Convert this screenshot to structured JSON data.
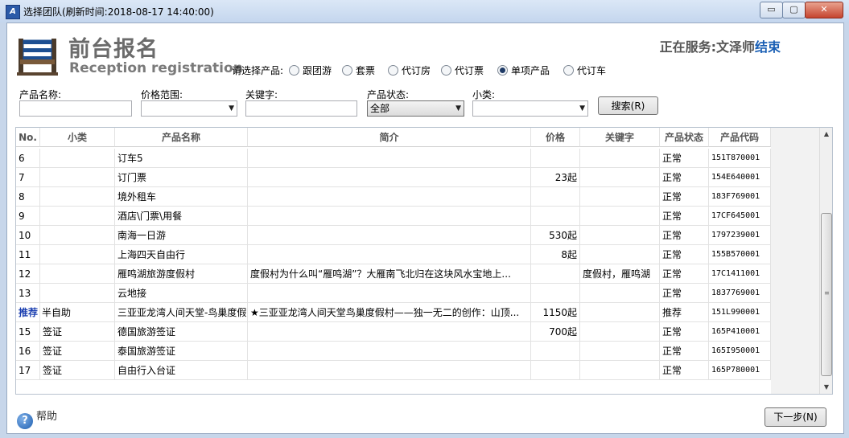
{
  "window": {
    "title": "选择团队(刷新时间:2018-08-17   14:40:00)",
    "controls": {
      "minimize": "▭",
      "maximize": "▢",
      "close": "✕"
    }
  },
  "header": {
    "title": "前台报名",
    "subtitle": "Reception registration",
    "serving_prefix": "正在服务:文泽师",
    "serving_action": "结束"
  },
  "product_type": {
    "label": "请选择产品:",
    "options": [
      "跟团游",
      "套票",
      "代订房",
      "代订票",
      "单项产品",
      "代订车"
    ],
    "selected_index": 4
  },
  "filters": {
    "name_label": "产品名称:",
    "name_value": "",
    "price_label": "价格范围:",
    "price_value": "",
    "keyword_label": "关键字:",
    "keyword_value": "",
    "status_label": "产品状态:",
    "status_value": "全部",
    "subtype_label": "小类:",
    "subtype_value": "",
    "search_label": "搜索(R)"
  },
  "table": {
    "columns": [
      "No.",
      "小类",
      "产品名称",
      "简介",
      "价格",
      "关键字",
      "产品状态",
      "产品代码"
    ],
    "rows": [
      {
        "no": "6",
        "tag": "",
        "subtype": "",
        "name": "订车5",
        "intro": "",
        "price": "",
        "keyword": "",
        "status": "正常",
        "code": "151T870001"
      },
      {
        "no": "7",
        "tag": "",
        "subtype": "",
        "name": "订门票",
        "intro": "",
        "price": "23起",
        "keyword": "",
        "status": "正常",
        "code": "154E640001"
      },
      {
        "no": "8",
        "tag": "",
        "subtype": "",
        "name": "境外租车",
        "intro": "",
        "price": "",
        "keyword": "",
        "status": "正常",
        "code": "183F769001"
      },
      {
        "no": "9",
        "tag": "",
        "subtype": "",
        "name": "酒店\\门票\\用餐",
        "intro": "",
        "price": "",
        "keyword": "",
        "status": "正常",
        "code": "17CF645001"
      },
      {
        "no": "10",
        "tag": "",
        "subtype": "",
        "name": "南海一日游",
        "intro": "",
        "price": "530起",
        "keyword": "",
        "status": "正常",
        "code": "1797239001"
      },
      {
        "no": "11",
        "tag": "",
        "subtype": "",
        "name": "上海四天自由行",
        "intro": "",
        "price": "8起",
        "keyword": "",
        "status": "正常",
        "code": "155B570001"
      },
      {
        "no": "12",
        "tag": "",
        "subtype": "",
        "name": "雁鸣湖旅游度假村",
        "intro": "度假村为什么叫“雁鸣湖”？大雁南飞北归在这块风水宝地上...",
        "price": "",
        "keyword": "度假村，雁鸣湖",
        "status": "正常",
        "code": "17C1411001"
      },
      {
        "no": "13",
        "tag": "",
        "subtype": "",
        "name": "云地接",
        "intro": "",
        "price": "",
        "keyword": "",
        "status": "正常",
        "code": "1837769001"
      },
      {
        "no": "",
        "tag": "推荐",
        "subtype": "半自助",
        "name": "三亚亚龙湾人间天堂-鸟巢度假",
        "intro": "★三亚亚龙湾人间天堂鸟巢度假村——独一无二的创作：山顶...",
        "price": "1150起",
        "keyword": "",
        "status": "推荐",
        "code": "151L990001"
      },
      {
        "no": "15",
        "tag": "",
        "subtype": "签证",
        "name": "德国旅游签证",
        "intro": "",
        "price": "700起",
        "keyword": "",
        "status": "正常",
        "code": "165P410001"
      },
      {
        "no": "16",
        "tag": "",
        "subtype": "签证",
        "name": "泰国旅游签证",
        "intro": "",
        "price": "",
        "keyword": "",
        "status": "正常",
        "code": "165I950001"
      },
      {
        "no": "17",
        "tag": "",
        "subtype": "签证",
        "name": "自由行入台证",
        "intro": "",
        "price": "",
        "keyword": "",
        "status": "正常",
        "code": "165P780001"
      }
    ]
  },
  "footer": {
    "help_label": "帮助",
    "next_label": "下一步(N)"
  },
  "colors": {
    "accent_link": "#1a5fb4",
    "tag_blue": "#1b3fb0",
    "title_bar": "#c4d6ee"
  }
}
